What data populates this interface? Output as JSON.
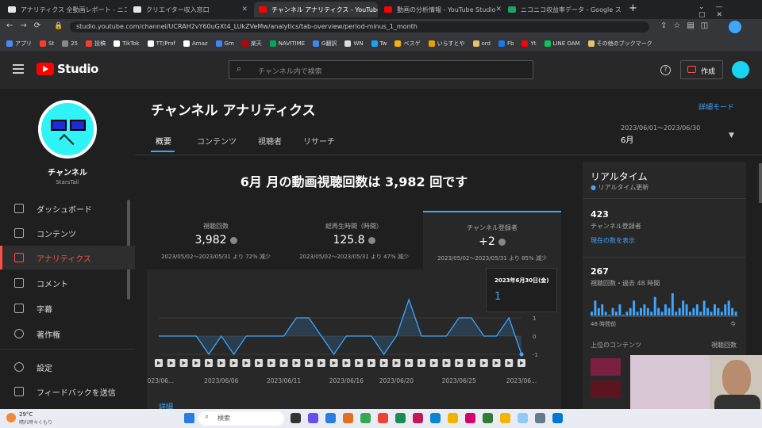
{
  "browser": {
    "tabs": [
      "アナリティクス 全動画レポート - ニコニコ",
      "クリエイター収入窓口",
      "チャンネル アナリティクス - YouTube Studio",
      "動画の分析情報 - YouTube Studio",
      "ニコニコ収益率データ - Google スプレッド"
    ],
    "new_tab": "+",
    "url": "studio.youtube.com/channel/UCRAH2vY60uGXt4_LUkZVeMw/analytics/tab-overview/period-minus_1_month",
    "bookmarks": [
      "アプリ",
      "St",
      "25",
      "投稿",
      "TikTok",
      "TT/Prof",
      "Amaz",
      "Gm",
      "楽天",
      "NAVITIME",
      "G翻訳",
      "WN",
      "Tw",
      "ベスゲ",
      "いらすとや",
      "ord",
      "Fb",
      "Yt",
      "LINE OAM",
      "その他のブックマーク"
    ]
  },
  "studio": {
    "logo": "Studio",
    "search_placeholder": "チャンネル内で検索",
    "create_label": "作成"
  },
  "sidebar": {
    "channel_name": "チャンネル",
    "channel_handle": "StarsTail",
    "items": [
      "ダッシュボード",
      "コンテンツ",
      "アナリティクス",
      "コメント",
      "字幕",
      "著作権",
      "設定",
      "フィードバックを送信"
    ]
  },
  "page": {
    "title": "チャンネル アナリティクス",
    "advanced_mode": "詳細モード",
    "tabs": [
      "概要",
      "コンテンツ",
      "視聴者",
      "リサーチ"
    ],
    "date_range": "2023/06/01～2023/06/30",
    "period": "6月",
    "headline": "6月 月の動画視聴回数は 3,982 回です"
  },
  "stats": [
    {
      "label": "視聴回数",
      "value": "3,982",
      "compare": "2023/05/02～2023/05/31 より 72% 減少"
    },
    {
      "label": "総再生時間（時間）",
      "value": "125.8",
      "compare": "2023/05/02～2023/05/31 より 47% 減少"
    },
    {
      "label": "チャンネル登録者",
      "value": "+2",
      "compare": "2023/05/02～2023/05/31 より 85% 減少"
    }
  ],
  "tooltip": {
    "date": "2023年6月30日(金)",
    "value": "1"
  },
  "details_link": "詳細",
  "chart_data": {
    "type": "area",
    "x": [
      "2023/06/01",
      "2023/06/02",
      "2023/06/03",
      "2023/06/04",
      "2023/06/05",
      "2023/06/06",
      "2023/06/07",
      "2023/06/08",
      "2023/06/09",
      "2023/06/10",
      "2023/06/11",
      "2023/06/12",
      "2023/06/13",
      "2023/06/14",
      "2023/06/15",
      "2023/06/16",
      "2023/06/17",
      "2023/06/18",
      "2023/06/19",
      "2023/06/20",
      "2023/06/21",
      "2023/06/22",
      "2023/06/23",
      "2023/06/24",
      "2023/06/25",
      "2023/06/26",
      "2023/06/27",
      "2023/06/28",
      "2023/06/29",
      "2023/06/30"
    ],
    "values": [
      0,
      0,
      0,
      0,
      -1,
      0,
      -1,
      0,
      0,
      0,
      0,
      1,
      1,
      0,
      -1,
      0,
      0,
      0,
      -1,
      0,
      2,
      0,
      0,
      0,
      1,
      1,
      0,
      0,
      1,
      -1
    ],
    "tick_labels": [
      "2023/06...",
      "2023/06/06",
      "2023/06/11",
      "2023/06/16",
      "2023/06/20",
      "2023/06/25",
      "2023/06..."
    ],
    "y_ticks": [
      "1",
      "0",
      "-1"
    ],
    "line_color": "#3ea6ff"
  },
  "realtime": {
    "title": "リアルタイム",
    "live_note": "リアルタイム更新",
    "subscribers": "423",
    "subscribers_label": "チャンネル登録者",
    "show_count": "現在の数を表示",
    "views": "267",
    "views_label": "視聴回数・過去 48 時間",
    "axis_left": "48 時間前",
    "axis_right": "今",
    "top_content": "上位のコンテンツ",
    "top_content_metric": "視聴回数",
    "bars": [
      1,
      4,
      2,
      3,
      1,
      0,
      2,
      1,
      3,
      0,
      1,
      2,
      4,
      1,
      2,
      3,
      2,
      1,
      5,
      2,
      1,
      3,
      2,
      6,
      1,
      2,
      4,
      3,
      1,
      2,
      3,
      1,
      4,
      2,
      1,
      3,
      2,
      1,
      3,
      4,
      2,
      1
    ]
  },
  "taskbar": {
    "weather_temp": "29°C",
    "weather_text": "晴れ時々くもり",
    "search": "検索"
  },
  "colors": {
    "accent": "#ff4e45",
    "link": "#3ea6ff",
    "bg": "#282828"
  }
}
